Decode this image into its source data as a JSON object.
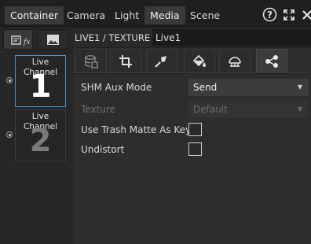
{
  "top_tabs": [
    {
      "label": "Container",
      "active": true
    },
    {
      "label": "Camera",
      "active": false
    },
    {
      "label": "Light",
      "active": false
    },
    {
      "label": "Media",
      "active": true
    },
    {
      "label": "Scene",
      "active": false
    }
  ],
  "top_icons": [
    "help-icon",
    "expand-icon",
    "close-icon"
  ],
  "left_panel": {
    "tabs": [
      "text-fx-icon",
      "image-icon"
    ],
    "channels": [
      {
        "label": "Live Channel",
        "number": "1",
        "selected": true
      },
      {
        "label": "Live Channel",
        "number": "2",
        "selected": false
      }
    ]
  },
  "breadcrumb": "LIVE1 / TEXTURE",
  "name_field_value": "Live1",
  "toolbar_icons": [
    "database-icon",
    "crop-icon",
    "brush-icon",
    "fill-bucket-icon",
    "sphere-icon",
    "share-nodes-icon"
  ],
  "properties": {
    "shm_aux_mode": {
      "label": "SHM Aux Mode",
      "value": "Send",
      "enabled": true
    },
    "texture": {
      "label": "Texture",
      "value": "Default",
      "enabled": false
    },
    "use_trash_matte": {
      "label": "Use Trash Matte As Key",
      "checked": false
    },
    "undistort": {
      "label": "Undistort",
      "checked": false
    }
  },
  "colors": {
    "accent_border": "#4a93c9",
    "bg": "#232323"
  }
}
